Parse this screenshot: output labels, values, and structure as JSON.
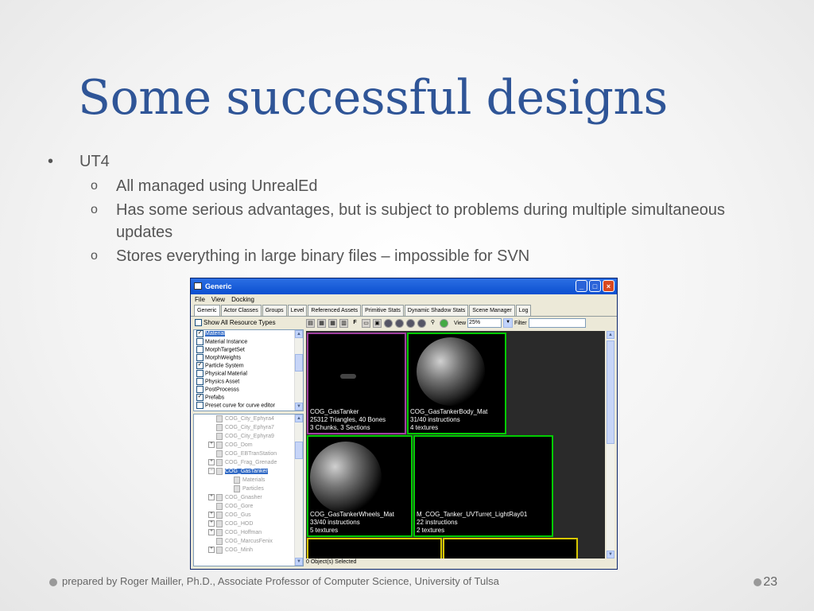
{
  "slide": {
    "title": "Some successful designs",
    "bullet": "UT4",
    "bullet_marker": "•",
    "sub_marker": "o",
    "sub_bullets": [
      "All managed using UnrealEd",
      "Has some serious advantages, but is subject to problems during multiple simultaneous updates",
      "Stores everything in large binary files – impossible for SVN"
    ],
    "footer": "prepared by Roger Mailler, Ph.D., Associate Professor of Computer Science, University of Tulsa",
    "page_number": "23"
  },
  "window": {
    "title": "Generic",
    "menu": [
      "File",
      "View",
      "Docking"
    ],
    "tabs": [
      "Generic",
      "Actor Classes",
      "Groups",
      "Level",
      "Referenced Assets",
      "Primitive Stats",
      "Dynamic Shadow Stats",
      "Scene Manager",
      "Log"
    ],
    "show_all_label": "Show All Resource Types",
    "resource_types": [
      {
        "label": "Material",
        "checked": true
      },
      {
        "label": "Material Instance",
        "checked": false
      },
      {
        "label": "MorphTargetSet",
        "checked": false
      },
      {
        "label": "MorphWeights",
        "checked": false
      },
      {
        "label": "Particle System",
        "checked": true
      },
      {
        "label": "Physical Material",
        "checked": false
      },
      {
        "label": "Physics Asset",
        "checked": false
      },
      {
        "label": "PostProcesss",
        "checked": false
      },
      {
        "label": "Prefabs",
        "checked": true
      },
      {
        "label": "Preset curve for curve editor",
        "checked": false
      }
    ],
    "tree_nodes": [
      {
        "label": "COG_City_Ephyra4",
        "expander": ""
      },
      {
        "label": "COG_City_Ephyra7",
        "expander": ""
      },
      {
        "label": "COG_City_Ephyra9",
        "expander": ""
      },
      {
        "label": "COG_Dom",
        "expander": "+"
      },
      {
        "label": "COG_EBTranStation",
        "expander": ""
      },
      {
        "label": "COG_Frag_Grenade",
        "expander": "+"
      },
      {
        "label": "COG_GasTanker",
        "expander": "−"
      },
      {
        "label": "Materials",
        "expander": ""
      },
      {
        "label": "Particles",
        "expander": ""
      },
      {
        "label": "COG_Gnasher",
        "expander": "+"
      },
      {
        "label": "COG_Gore",
        "expander": ""
      },
      {
        "label": "COG_Gus",
        "expander": "+"
      },
      {
        "label": "COG_HOD",
        "expander": "+"
      },
      {
        "label": "COG_Hoffman",
        "expander": "+"
      },
      {
        "label": "COG_MarcusFenix",
        "expander": ""
      },
      {
        "label": "COG_Minh",
        "expander": "+"
      }
    ],
    "view_label": "View",
    "view_value": "25%",
    "filter_label": "Filter",
    "thumbnails": [
      {
        "lines": [
          "COG_GasTanker",
          "25312 Triangles, 40 Bones",
          "3 Chunks, 3 Sections"
        ]
      },
      {
        "lines": [
          "COG_GasTankerBody_Mat",
          "31/40 instructions",
          "4 textures"
        ]
      },
      {
        "lines": [
          "COG_GasTankerWheels_Mat",
          "33/40 instructions",
          "5 textures"
        ]
      },
      {
        "lines": [
          "M_COG_Tanker_UVTurret_LightRay01",
          "22 instructions",
          "2 textures"
        ]
      }
    ],
    "status": "0 Object(s) Selected"
  }
}
